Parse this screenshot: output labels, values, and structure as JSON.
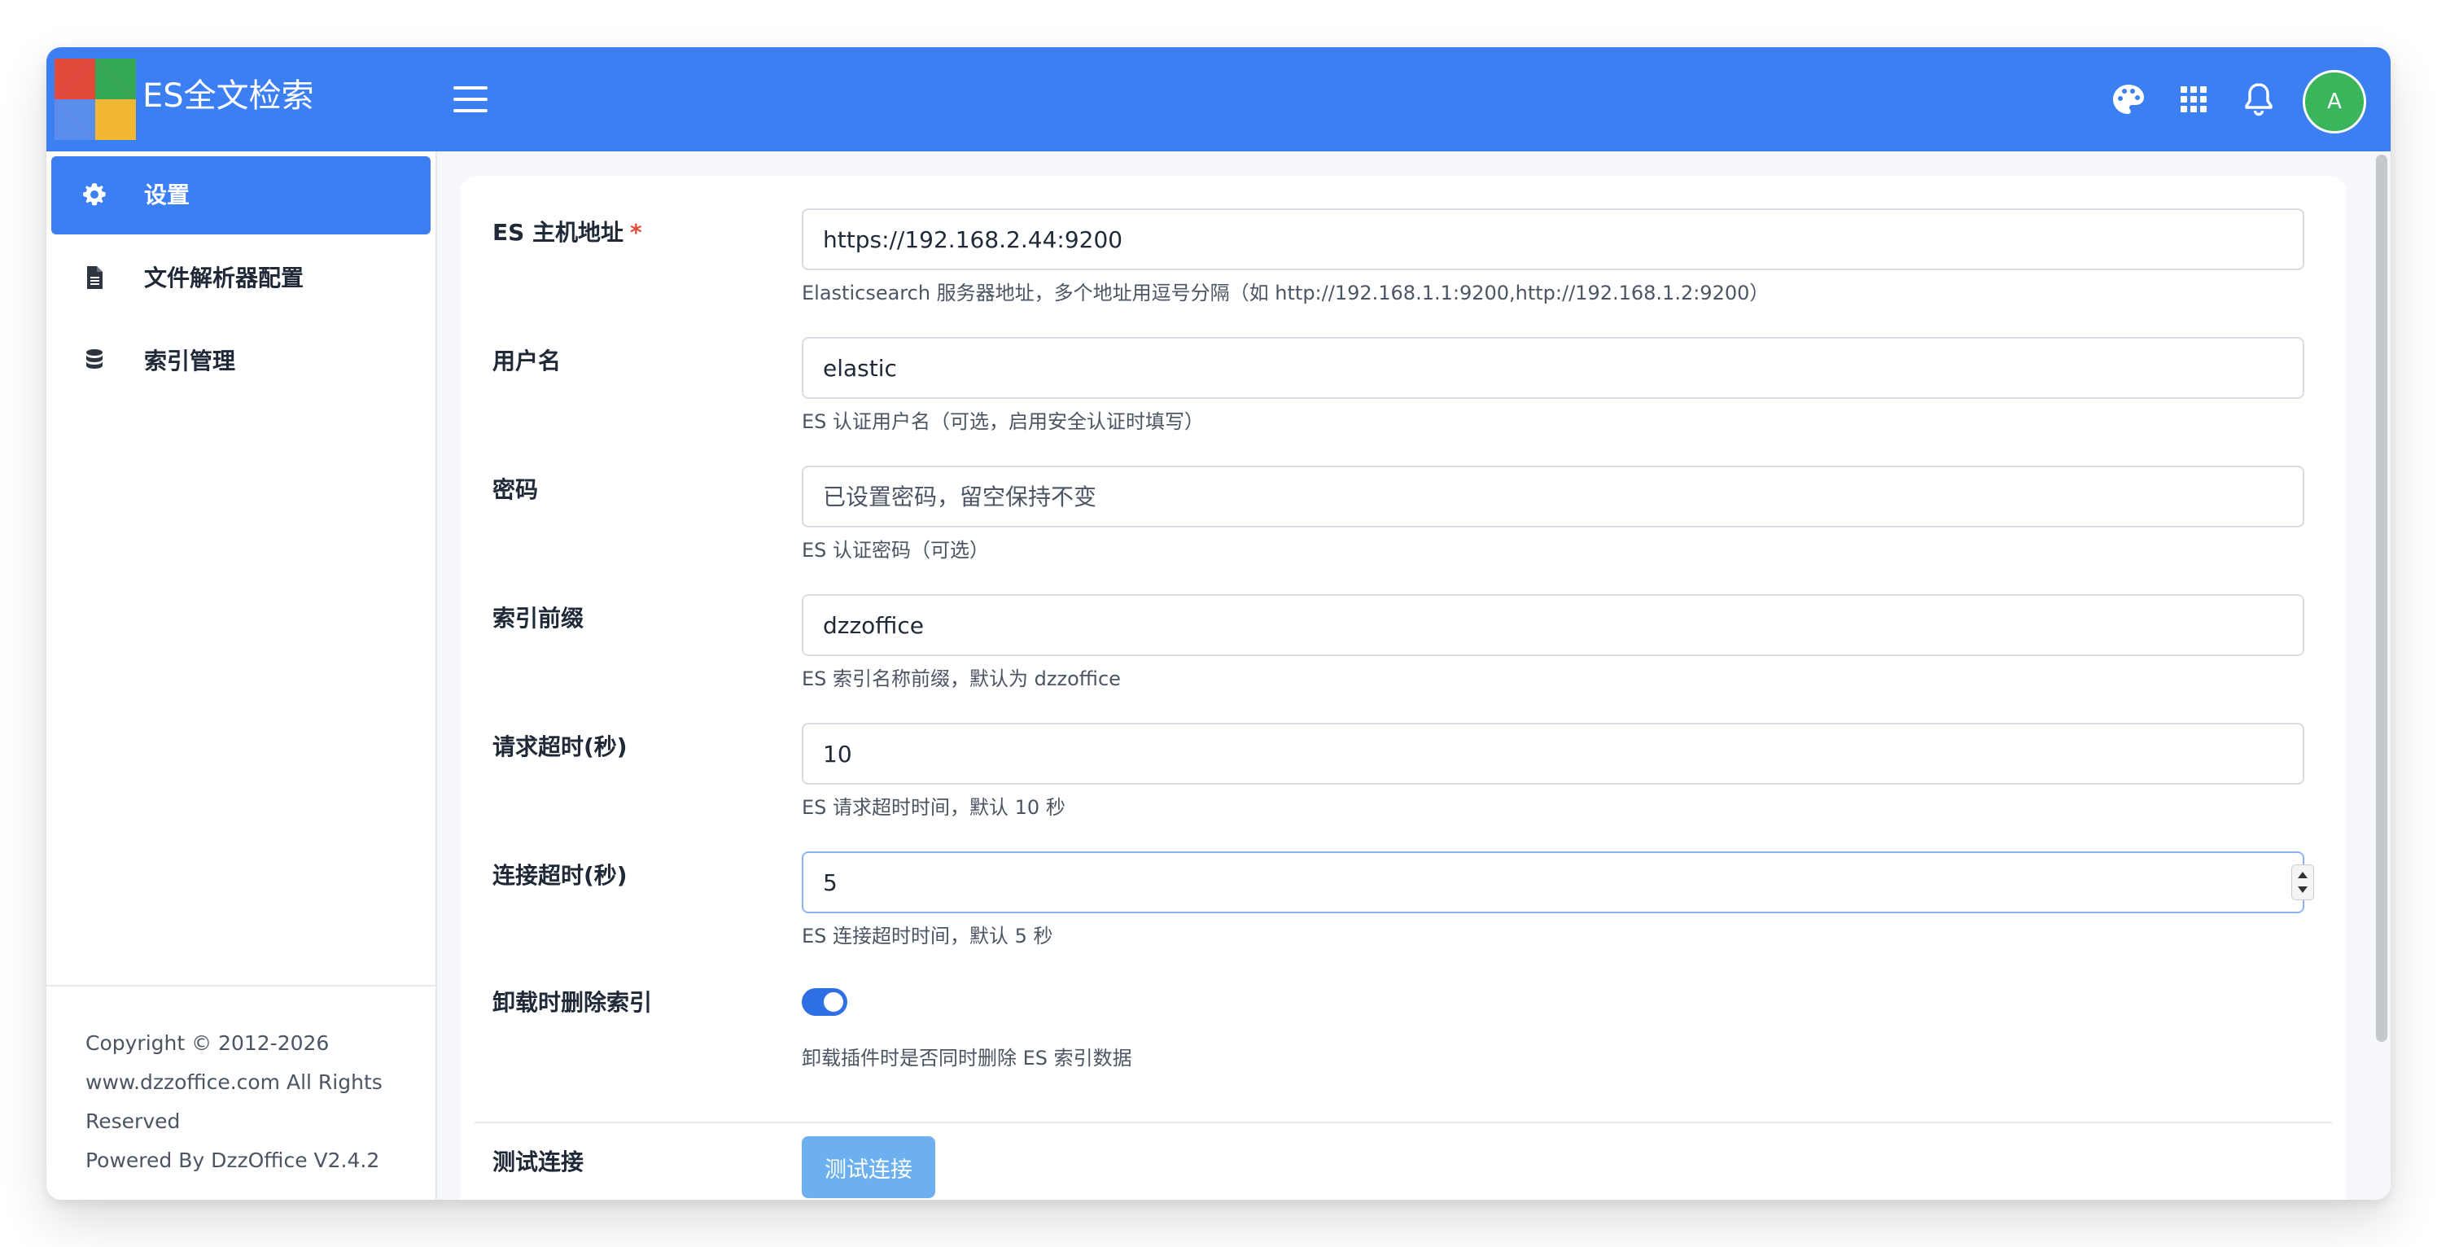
{
  "header": {
    "app_title": "ES全文检索",
    "avatar_letter": "A",
    "colors": {
      "header_bg": "#3b7ff3",
      "avatar_bg": "#3bb55c"
    },
    "icons": [
      "palette-icon",
      "apps-grid-icon",
      "bell-icon"
    ]
  },
  "sidebar": {
    "items": [
      {
        "label": "设置",
        "icon": "gear-icon",
        "active": true
      },
      {
        "label": "文件解析器配置",
        "icon": "file-icon",
        "active": false
      },
      {
        "label": "索引管理",
        "icon": "database-icon",
        "active": false
      }
    ],
    "copyright": {
      "line1": "Copyright © 2012-2026",
      "line2": "www.dzzoffice.com All Rights",
      "line3": "Reserved",
      "line4": "Powered By DzzOffice V2.4.2"
    }
  },
  "form": {
    "host": {
      "label": "ES 主机地址",
      "required_mark": "*",
      "value": "https://192.168.2.44:9200",
      "help": "Elasticsearch 服务器地址，多个地址用逗号分隔（如 http://192.168.1.1:9200,http://192.168.1.2:9200）"
    },
    "username": {
      "label": "用户名",
      "value": "elastic",
      "help": "ES 认证用户名（可选，启用安全认证时填写）"
    },
    "password": {
      "label": "密码",
      "value": "",
      "placeholder": "已设置密码，留空保持不变",
      "help": "ES 认证密码（可选）"
    },
    "index_prefix": {
      "label": "索引前缀",
      "value": "dzzoffice",
      "help": "ES 索引名称前缀，默认为 dzzoffice"
    },
    "request_timeout": {
      "label": "请求超时(秒)",
      "value": "10",
      "help": "ES 请求超时时间，默认 10 秒"
    },
    "connect_timeout": {
      "label": "连接超时(秒)",
      "value": "5",
      "help": "ES 连接超时时间，默认 5 秒"
    },
    "delete_on_uninstall": {
      "label": "卸载时删除索引",
      "enabled": true,
      "help": "卸载插件时是否同时删除 ES 索引数据"
    },
    "test_connection": {
      "label": "测试连接",
      "button_label": "测试连接"
    }
  }
}
